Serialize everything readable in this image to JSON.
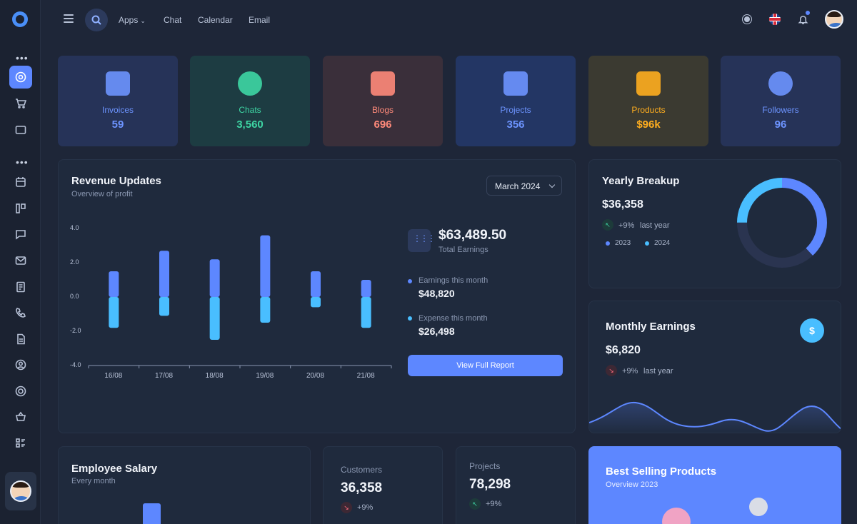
{
  "topbar": {
    "nav": [
      "Apps",
      "Chat",
      "Calendar",
      "Email"
    ]
  },
  "stats": [
    {
      "label": "Invoices",
      "value": "59",
      "bg": "#263358",
      "color": "#6d94ff",
      "icon": "share-nodes-icon"
    },
    {
      "label": "Chats",
      "value": "3,560",
      "bg": "#1d3c42",
      "color": "#3ed6a4",
      "icon": "chat-bubbles-icon"
    },
    {
      "label": "Blogs",
      "value": "696",
      "bg": "#3a2f3a",
      "color": "#ff8a7a",
      "icon": "bookmark-star-icon"
    },
    {
      "label": "Projects",
      "value": "356",
      "bg": "#233664",
      "color": "#6d94ff",
      "icon": "mailbox-icon"
    },
    {
      "label": "Products",
      "value": "$96k",
      "bg": "#3b3a31",
      "color": "#ffae1f",
      "icon": "briefcase-icon"
    },
    {
      "label": "Followers",
      "value": "96",
      "bg": "#263358",
      "color": "#6d94ff",
      "icon": "user-avatar-icon"
    }
  ],
  "revenue": {
    "title": "Revenue Updates",
    "subtitle": "Overview of profit",
    "month": "March 2024",
    "total_value": "$63,489.50",
    "total_label": "Total Earnings",
    "earnings_label": "Earnings this month",
    "earnings_value": "$48,820",
    "expense_label": "Expense this month",
    "expense_value": "$26,498",
    "button": "View Full Report"
  },
  "chart_data": {
    "type": "bar",
    "categories": [
      "16/08",
      "17/08",
      "18/08",
      "19/08",
      "20/08",
      "21/08"
    ],
    "yticks": [
      "4.0",
      "2.0",
      "0.0",
      "-2.0",
      "-4.0"
    ],
    "ylim": [
      -4,
      4
    ],
    "series": [
      {
        "values": [
          1.5,
          2.7,
          2.2,
          3.6,
          1.5,
          1.0
        ],
        "color": "#5d87ff"
      },
      {
        "values": [
          -1.8,
          -1.1,
          -2.5,
          -1.5,
          -0.6,
          -1.8
        ],
        "color": "#49beff"
      }
    ]
  },
  "yearly": {
    "title": "Yearly Breakup",
    "value": "$36,358",
    "pct": "+9%",
    "pct_label": "last year",
    "legend": [
      "2023",
      "2024"
    ],
    "donut": [
      {
        "value": 38,
        "color": "#5d87ff"
      },
      {
        "value": 37,
        "color": "#2a3450"
      },
      {
        "value": 25,
        "color": "#49beff"
      }
    ]
  },
  "monthly": {
    "title": "Monthly Earnings",
    "value": "$6,820",
    "pct": "+9%",
    "pct_label": "last year",
    "currency_icon": "$"
  },
  "salary": {
    "title": "Employee Salary",
    "subtitle": "Every month"
  },
  "customers": {
    "label": "Customers",
    "value": "36,358",
    "pct": "+9%"
  },
  "projects": {
    "label": "Projects",
    "value": "78,298",
    "pct": "+9%"
  },
  "best": {
    "title": "Best Selling Products",
    "subtitle": "Overview 2023"
  }
}
